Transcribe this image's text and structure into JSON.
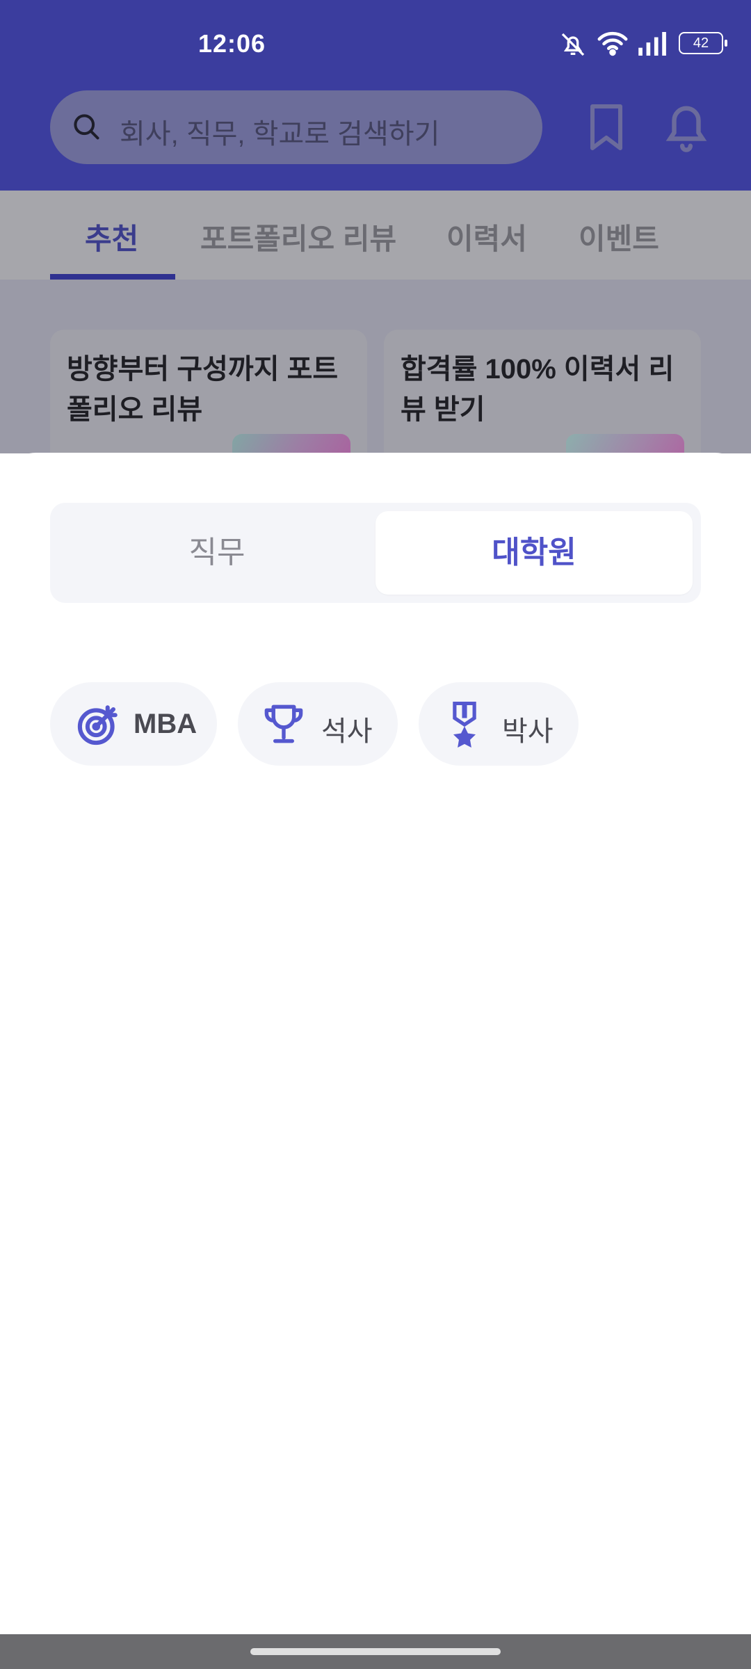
{
  "status_bar": {
    "time": "12:06",
    "battery_level": "42"
  },
  "search": {
    "placeholder": "회사, 직무, 학교로 검색하기"
  },
  "tabs": [
    {
      "label": "추천",
      "active": true
    },
    {
      "label": "포트폴리오 리뷰",
      "active": false
    },
    {
      "label": "이력서",
      "active": false
    },
    {
      "label": "이벤트",
      "active": false
    }
  ],
  "cards": [
    {
      "title": "방향부터 구성까지 포트폴리오 리뷰"
    },
    {
      "title": "합격률 100% 이력서 리뷰 받기"
    }
  ],
  "sheet": {
    "segments": [
      {
        "label": "직무",
        "selected": false
      },
      {
        "label": "대학원",
        "selected": true
      }
    ],
    "chips": [
      {
        "label": "MBA",
        "icon": "target-icon"
      },
      {
        "label": "석사",
        "icon": "trophy-icon"
      },
      {
        "label": "박사",
        "icon": "medal-icon"
      }
    ]
  },
  "colors": {
    "accent": "#4f52c8",
    "header_bg": "#3b3d9e",
    "chip_bg": "#f4f5f9"
  }
}
